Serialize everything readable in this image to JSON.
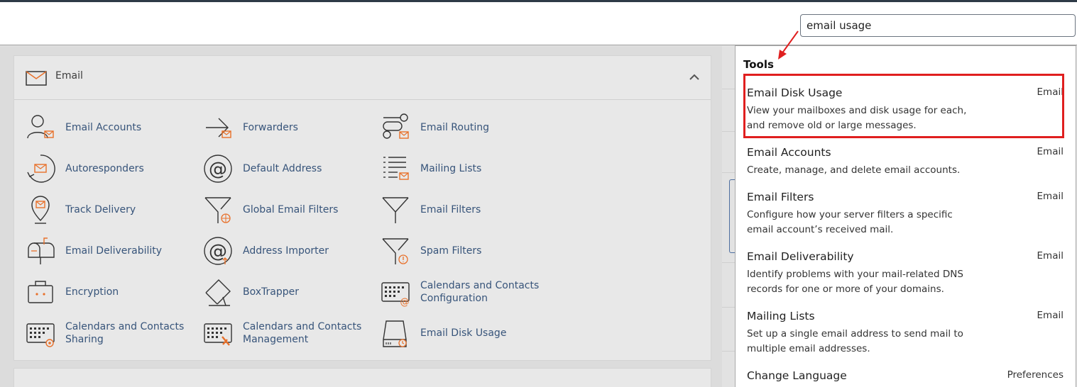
{
  "search": {
    "query": "email usage"
  },
  "section": {
    "title": "Email"
  },
  "tools": [
    {
      "label": "Email Accounts",
      "icon": "email-accounts-icon"
    },
    {
      "label": "Forwarders",
      "icon": "forwarders-icon"
    },
    {
      "label": "Email Routing",
      "icon": "email-routing-icon"
    },
    {
      "label": "Autoresponders",
      "icon": "autoresponders-icon"
    },
    {
      "label": "Default Address",
      "icon": "default-address-icon"
    },
    {
      "label": "Mailing Lists",
      "icon": "mailing-lists-icon"
    },
    {
      "label": "Track Delivery",
      "icon": "track-delivery-icon"
    },
    {
      "label": "Global Email Filters",
      "icon": "global-email-filters-icon"
    },
    {
      "label": "Email Filters",
      "icon": "email-filters-icon"
    },
    {
      "label": "Email Deliverability",
      "icon": "email-deliverability-icon"
    },
    {
      "label": "Address Importer",
      "icon": "address-importer-icon"
    },
    {
      "label": "Spam Filters",
      "icon": "spam-filters-icon"
    },
    {
      "label": "Encryption",
      "icon": "encryption-icon"
    },
    {
      "label": "BoxTrapper",
      "icon": "boxtrapper-icon"
    },
    {
      "label": "Calendars and Contacts Configuration",
      "icon": "calendars-config-icon"
    },
    {
      "label": "Calendars and Contacts Sharing",
      "icon": "calendars-sharing-icon"
    },
    {
      "label": "Calendars and Contacts Management",
      "icon": "calendars-management-icon"
    },
    {
      "label": "Email Disk Usage",
      "icon": "email-disk-usage-icon"
    }
  ],
  "dropdown": {
    "heading": "Tools",
    "results": [
      {
        "title": "Email Disk Usage",
        "desc": "View your mailboxes and disk usage for each, and remove old or large messages.",
        "category": "Email"
      },
      {
        "title": "Email Accounts",
        "desc": "Create, manage, and delete email accounts.",
        "category": "Email"
      },
      {
        "title": "Email Filters",
        "desc": "Configure how your server filters a specific email account’s received mail.",
        "category": "Email"
      },
      {
        "title": "Email Deliverability",
        "desc": "Identify problems with your mail-related DNS records for one or more of your domains.",
        "category": "Email"
      },
      {
        "title": "Mailing Lists",
        "desc": "Set up a single email address to send mail to multiple email addresses.",
        "category": "Email"
      },
      {
        "title": "Change Language",
        "desc": "",
        "category": "Preferences"
      }
    ]
  },
  "colors": {
    "accent": "#e8702a",
    "link": "#37547a",
    "highlight": "#e01f1f"
  }
}
